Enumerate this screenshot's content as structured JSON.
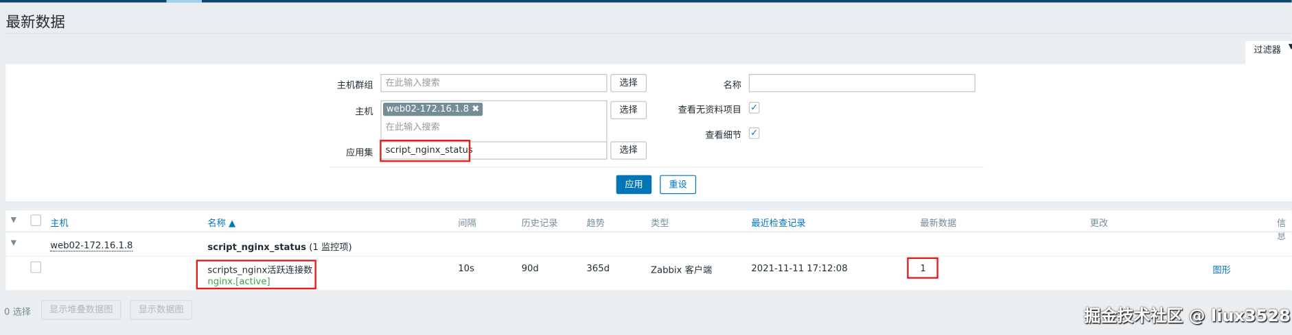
{
  "page": {
    "title": "最新数据",
    "filter_tab": "过滤器"
  },
  "filter": {
    "host_group": {
      "label": "主机群组",
      "placeholder": "在此输入搜索",
      "select": "选择"
    },
    "host": {
      "label": "主机",
      "tag": "web02-172.16.1.8",
      "placeholder": "在此输入搜索",
      "select": "选择"
    },
    "application": {
      "label": "应用集",
      "value": "script_nginx_status",
      "select": "选择"
    },
    "name": {
      "label": "名称",
      "value": ""
    },
    "show_no_data": {
      "label": "查看无资料项目",
      "checked": true
    },
    "show_details": {
      "label": "查看细节",
      "checked": true
    },
    "apply": "应用",
    "reset": "重设"
  },
  "table": {
    "headers": {
      "host": "主机",
      "name": "名称 ▲",
      "interval": "间隔",
      "history": "历史记录",
      "trends": "趋势",
      "type": "类型",
      "last_check": "最近检查记录",
      "last_value": "最新数据",
      "change": "更改",
      "info": "信息"
    },
    "group": {
      "host": "web02-172.16.1.8",
      "app": "script_nginx_status",
      "count": "(1 监控项)"
    },
    "rows": [
      {
        "name": "scripts_nginx活跃连接数",
        "key": "nginx.[active]",
        "interval": "10s",
        "history": "90d",
        "trends": "365d",
        "type": "Zabbix 客户端",
        "last_check": "2021-11-11 17:12:08",
        "last_value": "1",
        "change": "",
        "graph": "图形"
      }
    ]
  },
  "footer": {
    "selected": "0 选择",
    "stacked_graph": "显示堆叠数据图",
    "graph": "显示数据图"
  },
  "watermark": "掘金技术社区 @ liux3528"
}
